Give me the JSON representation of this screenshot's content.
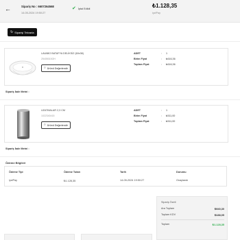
{
  "header": {
    "order_no": "Sipariş No : 6607264568",
    "order_date": "14-05-2024 19:50:27",
    "status": "İptal Edildi",
    "total_amount": "₺1.128,35",
    "payment_method": "iyziPay"
  },
  "reorder_button": {
    "label": "Siparişi Tekrarla"
  },
  "products": [
    {
      "name": "LAVABO BATAFYA DELİKSİZ (60x38)",
      "sku": "25405015OH",
      "rate_label": "Ürünü Değerlendir",
      "fields": [
        {
          "key": "ADET",
          "sep": ":",
          "value": "1"
        },
        {
          "key": "Birim Fiyat",
          "sep": ":",
          "value": "₺616,36"
        },
        {
          "key": "Toplam Fiyat",
          "sep": ":",
          "value": "₺616,36"
        }
      ],
      "return_reason": "Sipariş İade Metni :"
    },
    {
      "name": "UZATMALAR 2,3 CM",
      "sku": "1022340415",
      "rate_label": "Ürünü Değerlendir",
      "fields": [
        {
          "key": "ADET",
          "sep": ":",
          "value": "1"
        },
        {
          "key": "Birim Fiyat",
          "sep": ":",
          "value": "₺511,00"
        },
        {
          "key": "Toplam Fiyat",
          "sep": ":",
          "value": "₺511,00"
        }
      ],
      "return_reason": "Sipariş İade Metni :"
    }
  ],
  "payment": {
    "title": "Ödeme Bilgileri",
    "headers": [
      "Ödeme Tipi",
      "Ödeme Tutarı",
      "Tarih",
      "Durumu"
    ],
    "values": [
      "iyziPay",
      "₺1.128,35",
      "14-05-2024 19:50:27",
      "Onaylandı"
    ]
  },
  "summary": {
    "title": "Sipariş Özeti",
    "subtotal_label": "Ara Toplam",
    "subtotal_value": "₺940,30",
    "vat_label": "Toplam KDV",
    "vat_value": "₺188,05",
    "total_label": "Toplam",
    "total_value": "₺1.128,35"
  },
  "colors": {
    "accent_green": "#2fae4d",
    "button_dark": "#111111"
  },
  "icons": {
    "back": "arrow-left-icon",
    "status": "check-icon",
    "reorder": "refresh-icon",
    "rate": "chat-bubble-icon"
  }
}
